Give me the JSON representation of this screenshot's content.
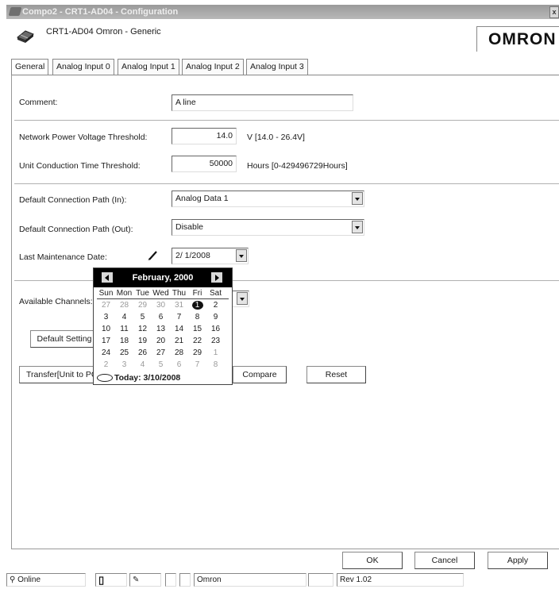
{
  "window": {
    "title": "Compo2 - CRT1-AD04 - Configuration",
    "close_label": "x"
  },
  "header": {
    "device_label": "CRT1-AD04  Omron - Generic",
    "brand": "OMRON"
  },
  "tabs": [
    {
      "label": "General",
      "active": true
    },
    {
      "label": "Analog Input 0",
      "active": false
    },
    {
      "label": "Analog Input 1",
      "active": false
    },
    {
      "label": "Analog Input 2",
      "active": false
    },
    {
      "label": "Analog Input 3",
      "active": false
    }
  ],
  "form": {
    "comment_label": "Comment:",
    "comment_value": "A line",
    "npv_label": "Network Power Voltage Threshold:",
    "npv_value": "14.0",
    "npv_unit": "V [14.0 - 26.4V]",
    "uct_label": "Unit Conduction Time Threshold:",
    "uct_value": "50000",
    "uct_unit": "Hours [0-429496729Hours]",
    "dcp_in_label": "Default Connection Path (In):",
    "dcp_in_value": "Analog Data 1",
    "dcp_out_label": "Default Connection Path (Out):",
    "dcp_out_value": "Disable",
    "lmd_label": "Last Maintenance Date:",
    "lmd_value": "2/ 1/2008",
    "avail_label": "Available Channels:"
  },
  "buttons": {
    "default_setting": "Default Setting",
    "transfer": "Transfer[Unit to PC]",
    "compare": "Compare",
    "reset": "Reset",
    "ok": "OK",
    "cancel": "Cancel",
    "apply": "Apply"
  },
  "calendar": {
    "month_label": "February, 2000",
    "dow": [
      "Sun",
      "Mon",
      "Tue",
      "Wed",
      "Thu",
      "Fri",
      "Sat"
    ],
    "rows": [
      [
        "27",
        "28",
        "29",
        "30",
        "31",
        "1",
        "2"
      ],
      [
        "3",
        "4",
        "5",
        "6",
        "7",
        "8",
        "9"
      ],
      [
        "10",
        "11",
        "12",
        "13",
        "14",
        "15",
        "16"
      ],
      [
        "17",
        "18",
        "19",
        "20",
        "21",
        "22",
        "23"
      ],
      [
        "24",
        "25",
        "26",
        "27",
        "28",
        "29",
        "1"
      ],
      [
        "2",
        "3",
        "4",
        "5",
        "6",
        "7",
        "8"
      ]
    ],
    "other_month": [
      [
        true,
        true,
        true,
        true,
        true,
        false,
        false
      ],
      [
        false,
        false,
        false,
        false,
        false,
        false,
        false
      ],
      [
        false,
        false,
        false,
        false,
        false,
        false,
        false
      ],
      [
        false,
        false,
        false,
        false,
        false,
        false,
        false
      ],
      [
        false,
        false,
        false,
        false,
        false,
        false,
        true
      ],
      [
        true,
        true,
        true,
        true,
        true,
        true,
        true
      ]
    ],
    "selected_day": "1",
    "today_label": "Today: 3/10/2008"
  },
  "statusbar": {
    "status": "Online",
    "vendor": "Omron",
    "revision": "Rev 1.02"
  }
}
